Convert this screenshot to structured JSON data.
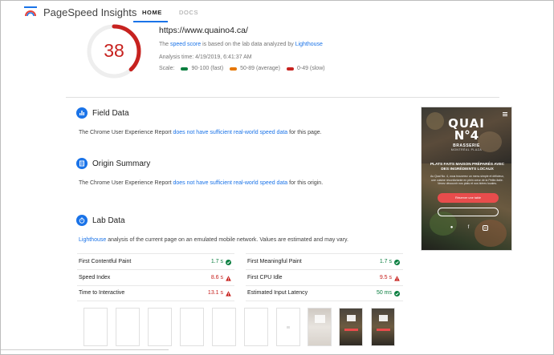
{
  "header": {
    "brand": "PageSpeed Insights",
    "tabs": [
      {
        "label": "HOME",
        "active": true
      },
      {
        "label": "DOCS",
        "active": false
      }
    ]
  },
  "summary": {
    "score": "38",
    "score_fraction": 0.38,
    "url": "https://www.quaino4.ca/",
    "desc_pre": "The ",
    "desc_link1": "speed score",
    "desc_mid": " is based on the lab data analyzed by ",
    "desc_link2": "Lighthouse",
    "analysis_time": "Analysis time: 4/19/2019, 6:41:37 AM",
    "scale_label": "Scale:",
    "scale": [
      {
        "label": "90-100 (fast)",
        "color": "#0a7e3f"
      },
      {
        "label": "50-89 (average)",
        "color": "#e67700"
      },
      {
        "label": "0-49 (slow)",
        "color": "#c7221f"
      }
    ]
  },
  "field_data": {
    "title": "Field Data",
    "text_pre": "The Chrome User Experience Report ",
    "text_link": "does not have sufficient real-world speed data",
    "text_post": " for this page."
  },
  "origin_summary": {
    "title": "Origin Summary",
    "text_pre": "The Chrome User Experience Report ",
    "text_link": "does not have sufficient real-world speed data",
    "text_post": " for this origin."
  },
  "lab_data": {
    "title": "Lab Data",
    "desc_link": "Lighthouse",
    "desc_rest": " analysis of the current page on an emulated mobile network. Values are estimated and may vary.",
    "metrics": [
      {
        "name": "First Contentful Paint",
        "value": "1.7 s",
        "status": "fast"
      },
      {
        "name": "First Meaningful Paint",
        "value": "1.7 s",
        "status": "fast"
      },
      {
        "name": "Speed Index",
        "value": "8.6 s",
        "status": "slow"
      },
      {
        "name": "First CPU Idle",
        "value": "9.5 s",
        "status": "slow"
      },
      {
        "name": "Time to Interactive",
        "value": "13.1 s",
        "status": "slow"
      },
      {
        "name": "Estimated Input Latency",
        "value": "50 ms",
        "status": "fast"
      }
    ]
  },
  "preview": {
    "line1": "QUAI",
    "line2": "N°4",
    "brasserie": "BRASSERIE",
    "location": "MONTRÉAL PLAZA",
    "tagline": "PLATS FAITS MAISON PRÉPARÉS AVEC DES INGRÉDIENTS LOCAUX",
    "blurb": "Au Quai No. 4, vous trouverez un menu simple et délicieux, une cuisine réconfortante en plein cœur de la Petite-Italie. Venez découvrir nos plats et nos bières locales.",
    "reserve_label": "Réserver une table"
  }
}
